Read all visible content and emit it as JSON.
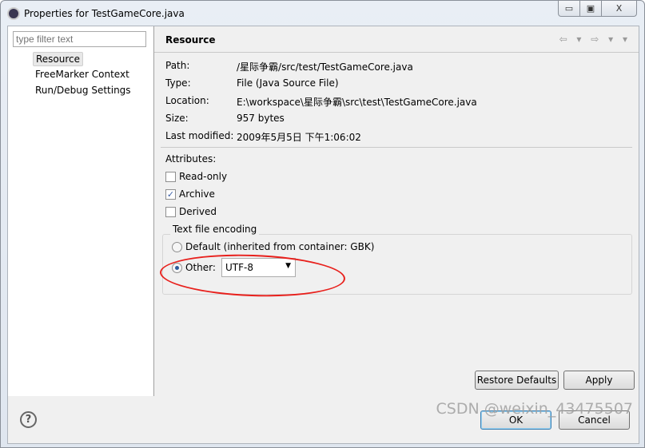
{
  "window": {
    "title": "Properties for TestGameCore.java",
    "minimize": "▭",
    "maximize": "▣",
    "close": "X"
  },
  "sidebar": {
    "filter_placeholder": "type filter text",
    "items": [
      {
        "label": "Resource",
        "selected": true
      },
      {
        "label": "FreeMarker Context"
      },
      {
        "label": "Run/Debug Settings"
      }
    ]
  },
  "page": {
    "title": "Resource",
    "nav": "⇦ ▾ ⇨ ▾ ▾",
    "info": [
      {
        "label": "Path:",
        "value": "/星际争霸/src/test/TestGameCore.java"
      },
      {
        "label": "Type:",
        "value": "File  (Java Source File)"
      },
      {
        "label": "Location:",
        "value": "E:\\workspace\\星际争霸\\src\\test\\TestGameCore.java"
      },
      {
        "label": "Size:",
        "value": "957  bytes"
      },
      {
        "label": "Last modified:",
        "value": "2009年5月5日 下午1:06:02"
      }
    ],
    "attributes_label": "Attributes:",
    "attributes": [
      {
        "label": "Read-only",
        "checked": false
      },
      {
        "label": "Archive",
        "checked": true
      },
      {
        "label": "Derived",
        "checked": false
      }
    ],
    "encoding": {
      "group_label": "Text file encoding",
      "default_label": "Default (inherited from container: GBK)",
      "other_label": "Other:",
      "selected": "other",
      "value": "UTF-8"
    },
    "restore_defaults": "Restore Defaults",
    "apply": "Apply"
  },
  "footer": {
    "help": "?",
    "ok": "OK",
    "cancel": "Cancel"
  },
  "watermark": "CSDN @weixin_43475507",
  "annotation_color": "#e8201c"
}
